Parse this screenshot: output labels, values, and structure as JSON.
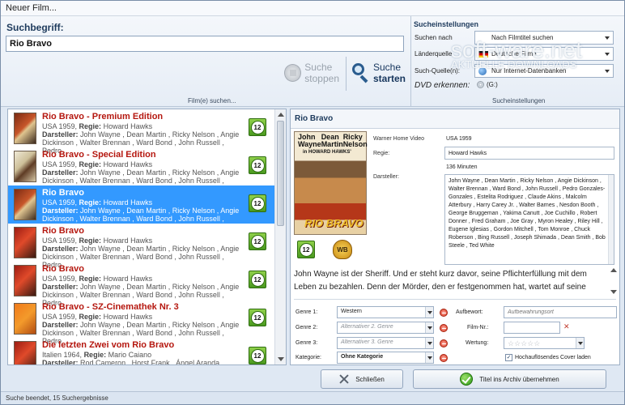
{
  "window": {
    "title": "Neuer Film..."
  },
  "search": {
    "label": "Suchbegriff:",
    "value": "Rio Bravo",
    "stop_line1": "Suche",
    "stop_line2": "stoppen",
    "start_line1": "Suche",
    "start_line2": "starten",
    "group_caption": "Film(e) suchen..."
  },
  "settings": {
    "title": "Sucheinstellungen",
    "search_in_label": "Suchen nach",
    "search_in_value": "Nach Filmtitel suchen",
    "country_label": "Länderquelle",
    "country_value": "Deutsche Filme",
    "source_label": "Such-Quelle(n):",
    "source_value": "Nur Internet-Datenbanken",
    "dvd_label": "DVD erkennen:",
    "dvd_value": "(G:)",
    "group_caption": "Sucheinstellungen"
  },
  "watermark": {
    "main": "soft-ware.net",
    "sub": "AKTUELLE DOWNLOADS"
  },
  "results": [
    {
      "title": "Rio Bravo - Premium Edition",
      "country_year": "USA 1959",
      "director_label": "Regie:",
      "director": "Howard Hawks",
      "cast_label": "Darsteller:",
      "cast": "John Wayne , Dean Martin , Ricky Nelson , Angie Dickinson , Walter Brennan , Ward Bond , John Russell , Pedro",
      "fsk": "12",
      "selected": false
    },
    {
      "title": "Rio Bravo - Special Edition",
      "country_year": "USA 1959",
      "director_label": "Regie:",
      "director": "Howard Hawks",
      "cast_label": "Darsteller:",
      "cast": "John Wayne , Dean Martin , Ricky Nelson , Angie Dickinson , Walter Brennan , Ward Bond , John Russell , Pedro",
      "fsk": "12",
      "selected": false
    },
    {
      "title": "Rio Bravo",
      "country_year": "USA 1959",
      "director_label": "Regie:",
      "director": "Howard Hawks",
      "cast_label": "Darsteller:",
      "cast": "John Wayne , Dean Martin , Ricky Nelson , Angie Dickinson , Walter Brennan , Ward Bond , John Russell , Pedro",
      "fsk": "12",
      "selected": true
    },
    {
      "title": "Rio Bravo",
      "country_year": "USA 1959",
      "director_label": "Regie:",
      "director": "Howard Hawks",
      "cast_label": "Darsteller:",
      "cast": "John Wayne , Dean Martin , Ricky Nelson , Angie Dickinson , Walter Brennan , Ward Bond , John Russell , Pedro",
      "fsk": "12",
      "selected": false
    },
    {
      "title": "Rio Bravo",
      "country_year": "USA 1959",
      "director_label": "Regie:",
      "director": "Howard Hawks",
      "cast_label": "Darsteller:",
      "cast": "John Wayne , Dean Martin , Ricky Nelson , Angie Dickinson , Walter Brennan , Ward Bond , John Russell , Pedro",
      "fsk": "12",
      "selected": false
    },
    {
      "title": "Rio Bravo - SZ-Cinemathek Nr. 3",
      "country_year": "USA 1959",
      "director_label": "Regie:",
      "director": "Howard Hawks",
      "cast_label": "Darsteller:",
      "cast": "John Wayne , Dean Martin , Ricky Nelson , Angie Dickinson , Walter Brennan , Ward Bond , John Russell , Pedro",
      "fsk": "12",
      "selected": false
    },
    {
      "title": "Die letzten Zwei vom Rio Bravo",
      "country_year": "Italien 1964",
      "director_label": "Regie:",
      "director": "Mario Caiano",
      "cast_label": "Darsteller:",
      "cast": "Rod Cameron , Horst Frank , Ángel Aranda",
      "fsk": "12",
      "selected": false
    }
  ],
  "detail": {
    "title": "Rio Bravo",
    "poster_actor1": "John Wayne",
    "poster_actor2": "Dean Martin",
    "poster_actor3": "Ricky Nelson",
    "poster_in": "in HOWARD HAWKS'",
    "poster_title": "RIO BRAVO",
    "wb_logo": "WB",
    "fsk": "12",
    "studio": "Warner Home Video",
    "country_year": "USA 1959",
    "director_label": "Regie:",
    "director": "Howard Hawks",
    "runtime": "136 Minuten",
    "cast_label": "Darsteller:",
    "cast": "John Wayne , Dean Martin , Ricky Nelson , Angie Dickinson , Walter Brennan , Ward Bond , John Russell , Pedro Gonzales-Gonzales , Estelita Rodriguez , Claude Akins , Malcolm Atterbury , Harry Carey Jr. , Walter Barnes , Nesdon Booth , George Bruggeman , Yakima Canutt , Joe Cuchillo , Robert Donner , Fred Graham , Joe Gray , Myron Healey , Riley Hill , Eugene Iglesias , Gordon Mitchell , Tom Monroe , Chuck Roberson , Bing Russell , Joseph Shimada , Dean Smith , Bob Steele , Ted White",
    "plot": "John Wayne ist der Sheriff. Und er steht kurz davor, seine Pflichterfüllung mit dem Leben zu bezahlen. Denn der Mörder, den er festgenommen hat, wartet auf seine"
  },
  "form": {
    "genre1_label": "Genre 1:",
    "genre1_value": "Western",
    "genre2_label": "Genre 2:",
    "genre2_placeholder": "Alternativer 2. Genre",
    "genre3_label": "Genre 3:",
    "genre3_placeholder": "Alternativer 3. Genre",
    "category_label": "Kategorie:",
    "category_value": "Ohne Kategorie",
    "storage_label": "Aufbewort:",
    "storage_placeholder": "Aufbewahrungsort",
    "film_nr_label": "Film-Nr.:",
    "rating_label": "Wertung:",
    "rating_stars": "☆☆☆☆☆",
    "hires_label": "Hochauflösendes Cover laden",
    "hires_checked": "✓"
  },
  "buttons": {
    "close": "Schließen",
    "accept": "Titel ins Archiv übernehmen"
  },
  "status": {
    "text": "Suche beendet, 15 Suchergebnisse"
  }
}
